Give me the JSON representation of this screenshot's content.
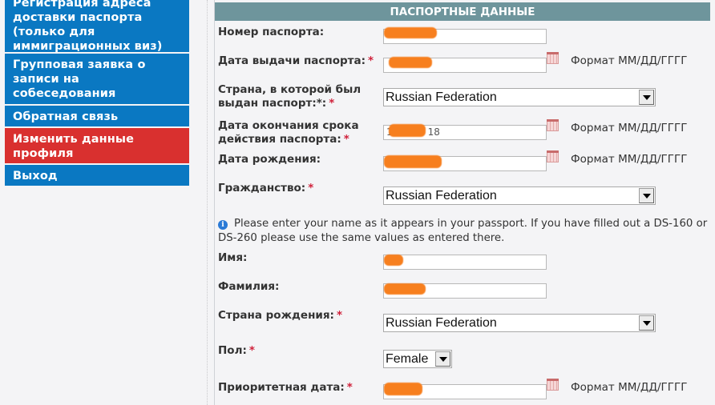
{
  "sidebar": {
    "items": [
      {
        "label": "Регистрация адреса доставки паспорта (только для иммиграционных виз)",
        "active": false
      },
      {
        "label": "Групповая заявка о записи на собеседования",
        "active": false
      },
      {
        "label": "Обратная связь",
        "active": false
      },
      {
        "label": "Изменить данные профиля",
        "active": true
      },
      {
        "label": "Выход",
        "active": false
      }
    ]
  },
  "colors": {
    "nav_blue": "#0a78c2",
    "nav_active_red": "#d9302f",
    "section_header": "#6e959c",
    "required_star": "#d0213b",
    "redaction": "#f77f1e"
  },
  "section": {
    "title": "ПАСПОРТНЫЕ ДАННЫЕ"
  },
  "form": {
    "required_mark": "*",
    "format_hint": "Формат ММ/ДД/ГГГГ",
    "passport_number": {
      "label": "Номер паспорта:",
      "value": "[redacted]"
    },
    "issue_date": {
      "label": "Дата выдачи паспорта:",
      "value": "[redacted]"
    },
    "issuing_country": {
      "label": "Страна, в которой был выдан паспорт:*:",
      "value": "Russian Federation"
    },
    "expiration_date": {
      "label": "Дата окончания срока действия паспорта:",
      "value_prefix": "1",
      "value_suffix": "18"
    },
    "birth_date": {
      "label": "Дата рождения:",
      "value": "[redacted]"
    },
    "citizenship": {
      "label": "Гражданство:",
      "value": "Russian Federation"
    },
    "name_notice": "Please enter your name as it appears in your passport. If you have filled out a DS-160 or DS-260 please use the same values as entered there.",
    "first_name": {
      "label": "Имя:",
      "value": "[redacted]"
    },
    "last_name": {
      "label": "Фамилия:",
      "value": "[redacted]"
    },
    "birth_country": {
      "label": "Страна рождения:",
      "value": "Russian Federation"
    },
    "gender": {
      "label": "Пол:",
      "value": "Female"
    },
    "priority_date": {
      "label": "Приоритетная дата:",
      "value": "[redacted]"
    }
  }
}
